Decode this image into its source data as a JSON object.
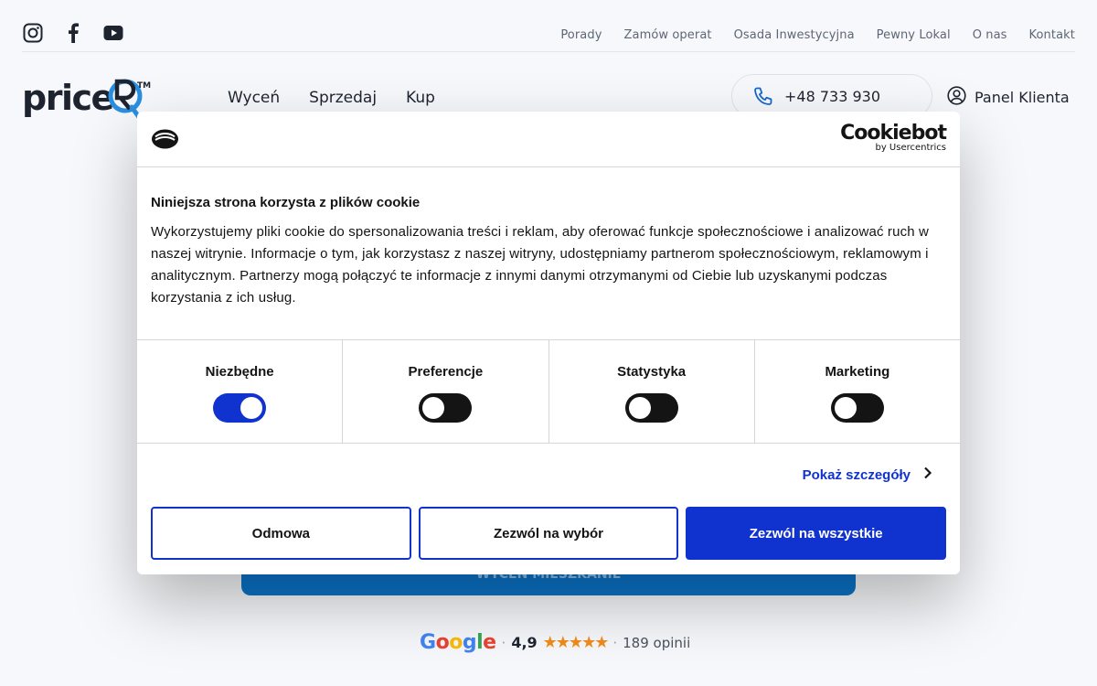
{
  "top_links": [
    "Porady",
    "Zamów operat",
    "Osada Inwestycyjna",
    "Pewny Lokal",
    "O nas",
    "Kontakt"
  ],
  "social_icons": [
    "instagram-icon",
    "facebook-icon",
    "youtube-icon"
  ],
  "logo": {
    "text": "priceR",
    "tm": "TM"
  },
  "main_nav": [
    "Wyceń",
    "Sprzedaj",
    "Kup"
  ],
  "phone": "+48 733 930",
  "panel_label": "Panel Klienta",
  "cta_label": "WYCEŃ MIESZKANIE",
  "rating": {
    "brand": "Google",
    "score": "4,9",
    "stars": 5,
    "count_label": "189 opinii"
  },
  "cookie_dialog": {
    "brand": "Cookiebot",
    "brand_sub": "by Usercentrics",
    "title": "Niniejsza strona korzysta z plików cookie",
    "text": "Wykorzystujemy pliki cookie do spersonalizowania treści i reklam, aby oferować funkcje społecznościowe i analizować ruch w naszej witrynie. Informacje o tym, jak korzystasz z naszej witryny, udostępniamy partnerom społecznościowym, reklamowym i analitycznym. Partnerzy mogą połączyć te informacje z innymi danymi otrzymanymi od Ciebie lub uzyskanymi podczas korzystania z ich usług.",
    "categories": [
      {
        "label": "Niezbędne",
        "enabled": true
      },
      {
        "label": "Preferencje",
        "enabled": false
      },
      {
        "label": "Statystyka",
        "enabled": false
      },
      {
        "label": "Marketing",
        "enabled": false
      }
    ],
    "details_link": "Pokaż szczegóły",
    "buttons": {
      "deny": "Odmowa",
      "allow_selection": "Zezwól na wybór",
      "allow_all": "Zezwól na wszystkie"
    }
  },
  "colors": {
    "accent": "#1032cf",
    "cta": "#0b74c8",
    "star": "#f28c18"
  }
}
